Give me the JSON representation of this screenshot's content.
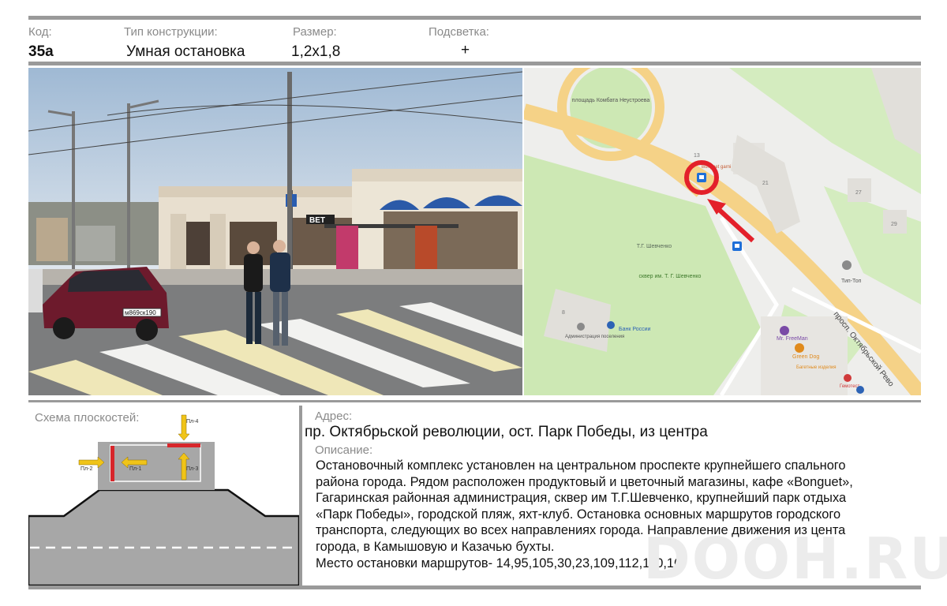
{
  "header": {
    "code_label": "Код:",
    "code_value": "35а",
    "type_label": "Тип конструкции:",
    "type_value": "Умная остановка",
    "size_label": "Размер:",
    "size_value": "1,2х1,8",
    "light_label": "Подсветка:",
    "light_value": "+"
  },
  "photo": {
    "plate": "м869ск190",
    "sign": "ВЕТ"
  },
  "map": {
    "square_label": "площадь Комбата Неустроева",
    "bld_13": "13",
    "cafe_label": "Bonguet garni",
    "bld_21": "21",
    "bld_27": "27",
    "bld_29": "29",
    "bld_8": "8",
    "monument_label": "Т.Г. Шевченко",
    "park_label": "сквер им. Т. Г. Шевченко",
    "poi_tiptop": "Тип-Топ",
    "poi_bank": "Банк России",
    "poi_admin": "Администрация поселения",
    "poi_freeman": "Mr. FreeMan",
    "poi_greendog": "Green Dog",
    "poi_bagel": "Багетные изделия",
    "poi_gemotest": "Гемотест",
    "street_label": "просп. Октябрьской Рево",
    "colors": {
      "marker": "#e3202a",
      "road": "#f5d287",
      "park": "#cde8b4",
      "bus": "#1e6fd8"
    }
  },
  "scheme": {
    "title": "Схема плоскостей:",
    "p1": "Пл-1",
    "p2": "Пл-2",
    "p3": "Пл-3",
    "p4": "Пл-4"
  },
  "address": {
    "label": "Адрес:",
    "value": "пр. Октябрьской революции, ост. Парк Победы, из центра"
  },
  "description": {
    "label": "Описание:",
    "lines": [
      "Остановочный комплекс установлен на центральном проспекте крупнейшего спального",
      "района города. Рядом  расположен продуктовый и цветочный магазины, кафе «Bonguet»,",
      "Гагаринская районная администрация, сквер им Т.Г.Шевченко, крупнейший парк отдыха",
      "«Парк Победы», городской пляж, яхт-клуб. Остановка основных маршрутов городского",
      "транспорта, следующих во всех направлениях города. Направление движения из цента",
      "города, в  Камышовую и Казачью  бухты.",
      "Место остановки маршрутов- 14,95,105,30,23,109,112,110,16."
    ]
  },
  "watermark": "DOOH.RU"
}
